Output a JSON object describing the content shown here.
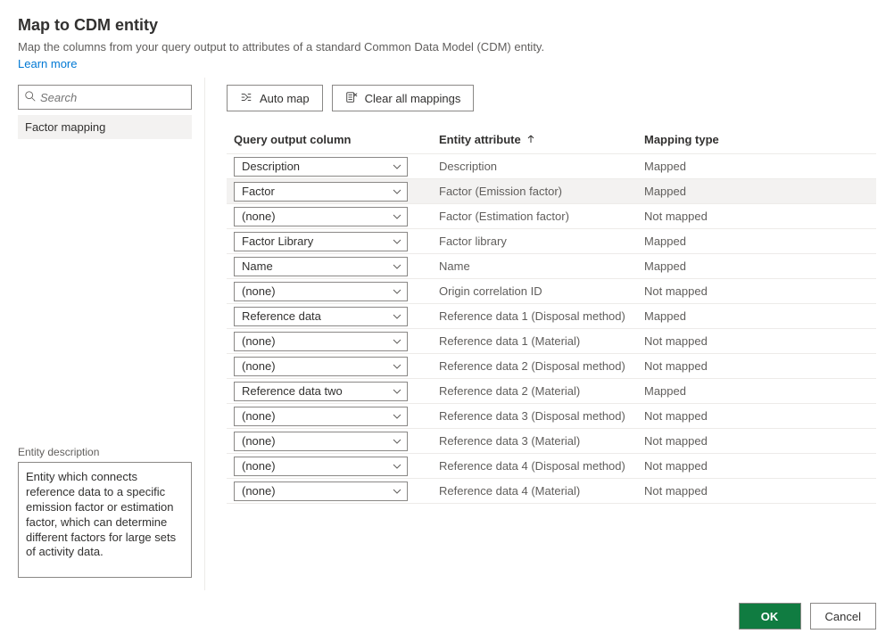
{
  "header": {
    "title": "Map to CDM entity",
    "subtitle": "Map the columns from your query output to attributes of a standard Common Data Model (CDM) entity.",
    "learn_more": "Learn more"
  },
  "sidebar": {
    "search_placeholder": "Search",
    "entities": [
      {
        "label": "Factor mapping"
      }
    ],
    "desc_label": "Entity description",
    "desc_text": "Entity which connects reference data to a specific emission factor or estimation factor, which can determine different factors for large sets of activity data."
  },
  "toolbar": {
    "automap_label": "Auto map",
    "clear_label": "Clear all mappings"
  },
  "table": {
    "col_output": "Query output column",
    "col_attr": "Entity attribute",
    "col_type": "Mapping type",
    "rows": [
      {
        "output": "Description",
        "attr": "Description",
        "type": "Mapped",
        "highlight": false
      },
      {
        "output": "Factor",
        "attr": "Factor (Emission factor)",
        "type": "Mapped",
        "highlight": true
      },
      {
        "output": "(none)",
        "attr": "Factor (Estimation factor)",
        "type": "Not mapped",
        "highlight": false
      },
      {
        "output": "Factor Library",
        "attr": "Factor library",
        "type": "Mapped",
        "highlight": false
      },
      {
        "output": "Name",
        "attr": "Name",
        "type": "Mapped",
        "highlight": false
      },
      {
        "output": "(none)",
        "attr": "Origin correlation ID",
        "type": "Not mapped",
        "highlight": false
      },
      {
        "output": "Reference data",
        "attr": "Reference data 1 (Disposal method)",
        "type": "Mapped",
        "highlight": false
      },
      {
        "output": "(none)",
        "attr": "Reference data 1 (Material)",
        "type": "Not mapped",
        "highlight": false
      },
      {
        "output": "(none)",
        "attr": "Reference data 2 (Disposal method)",
        "type": "Not mapped",
        "highlight": false
      },
      {
        "output": "Reference data two",
        "attr": "Reference data 2 (Material)",
        "type": "Mapped",
        "highlight": false
      },
      {
        "output": "(none)",
        "attr": "Reference data 3 (Disposal method)",
        "type": "Not mapped",
        "highlight": false
      },
      {
        "output": "(none)",
        "attr": "Reference data 3 (Material)",
        "type": "Not mapped",
        "highlight": false
      },
      {
        "output": "(none)",
        "attr": "Reference data 4 (Disposal method)",
        "type": "Not mapped",
        "highlight": false
      },
      {
        "output": "(none)",
        "attr": "Reference data 4 (Material)",
        "type": "Not mapped",
        "highlight": false
      }
    ]
  },
  "footer": {
    "ok_label": "OK",
    "cancel_label": "Cancel"
  }
}
